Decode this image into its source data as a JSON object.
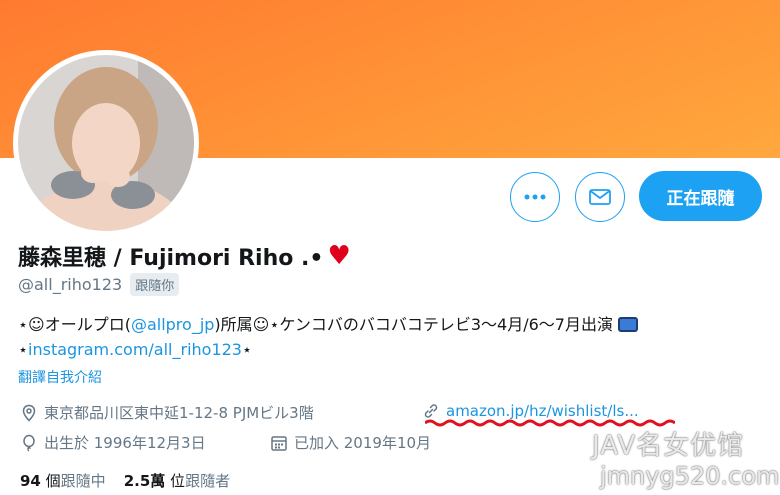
{
  "profile": {
    "name": "藤森里穂 / Fujimori Riho .•",
    "heart": "♥",
    "handle": "@all_riho123",
    "follows_you": "跟隨你",
    "bio_line1_prefix": "⋆☺オールプロ(",
    "bio_line1_link": "@allpro_jp",
    "bio_line1_suffix": ")所属☺⋆ケンコバのバコバコテレビ3〜4月/6〜7月出演",
    "bio_line2_prefix": "⋆",
    "bio_line2_link": "instagram.com/all_riho123",
    "bio_line2_suffix": "⋆",
    "translate": "翻譯自我介紹",
    "location": "東京都品川区東中延1-12-8 PJMビル3階",
    "website": "amazon.jp/hz/wishlist/ls...",
    "birthday": "出生於 1996年12月3日",
    "joined": "已加入 2019年10月"
  },
  "stats": {
    "following_count": "94",
    "following_label_pre": "個",
    "following_label": "跟隨中",
    "followers_count": "2.5萬",
    "followers_label_pre": "位",
    "followers_label": "跟隨者"
  },
  "buttons": {
    "follow": "正在跟隨"
  },
  "watermark": {
    "line1": "JAV名女优馆",
    "line2": "jmnyg520.com"
  },
  "colors": {
    "accent": "#1da1f2",
    "banner": "#ff8f35",
    "link": "#1b95e0"
  }
}
